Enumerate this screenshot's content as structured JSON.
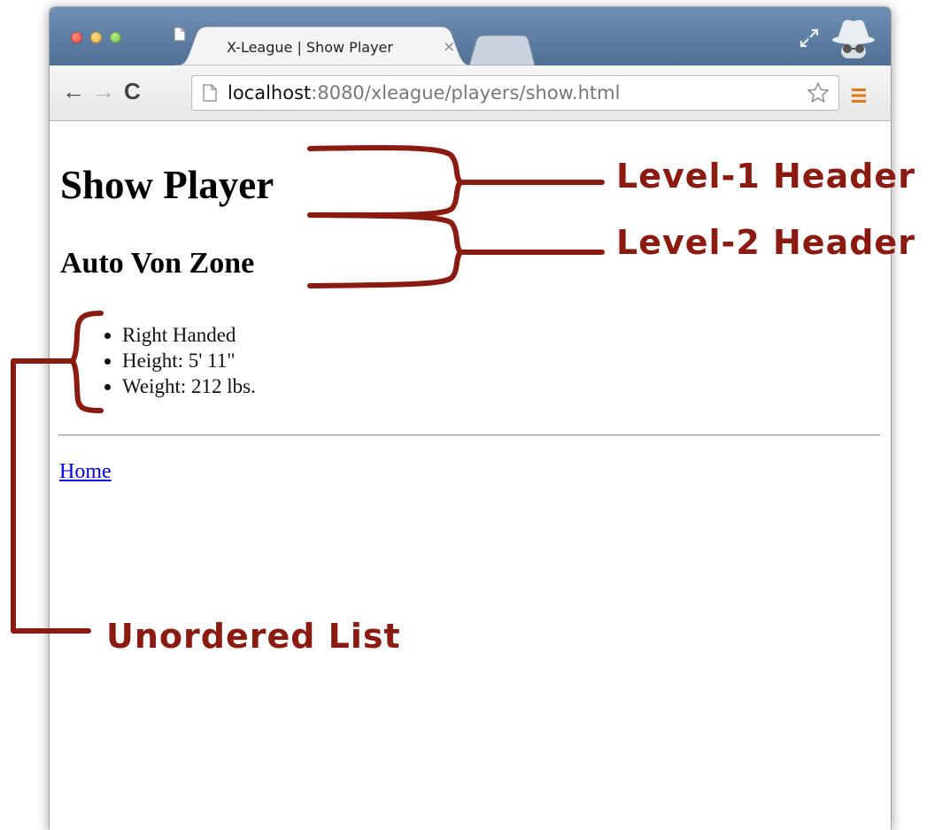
{
  "browser": {
    "tab_title": "X-League | Show Player",
    "tab_close": "×",
    "url_host": "localhost",
    "url_rest": ":8080/xleague/players/show.html",
    "back": "←",
    "forward": "→",
    "reload": "C"
  },
  "page": {
    "h1": "Show Player",
    "h2": "Auto Von Zone",
    "list": [
      "Right Handed",
      "Height: 5' 11\"",
      "Weight: 212 lbs."
    ],
    "home_link": "Home"
  },
  "annotations": {
    "level1": "Level-1 Header",
    "level2": "Level-2 Header",
    "unordered_list": "Unordered List"
  },
  "colors": {
    "annotation": "#8b1a10",
    "link": "#0000ee",
    "titlebar": "#5a7aa0"
  },
  "icons": [
    "page-icon",
    "star-icon",
    "menu-icon",
    "fullscreen-icon",
    "incognito-icon"
  ]
}
